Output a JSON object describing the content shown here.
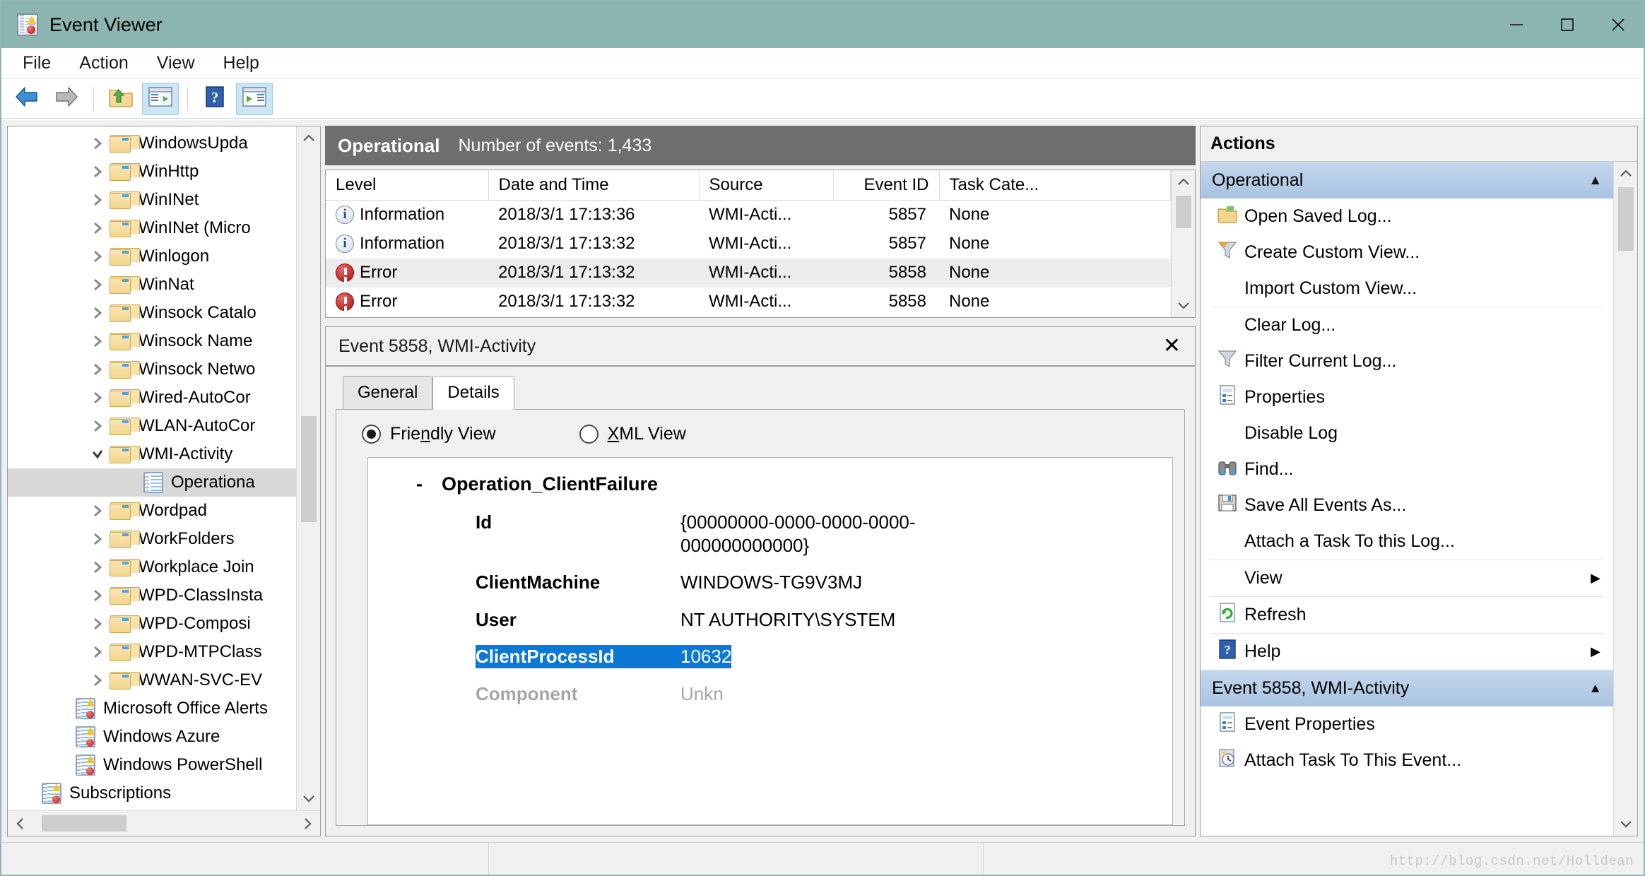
{
  "window": {
    "title": "Event Viewer",
    "icon": "event-viewer-icon",
    "minimize": "minimize-icon",
    "maximize": "maximize-icon",
    "close": "close-icon"
  },
  "menubar": {
    "items": [
      {
        "label": "File"
      },
      {
        "label": "Action"
      },
      {
        "label": "View"
      },
      {
        "label": "Help"
      }
    ]
  },
  "toolbar": {
    "buttons": [
      {
        "name": "back-button",
        "icon": "back-arrow-icon",
        "active": false
      },
      {
        "name": "forward-button",
        "icon": "forward-arrow-icon",
        "active": false
      },
      {
        "name": "up-one-level-button",
        "icon": "folder-up-icon",
        "active": false
      },
      {
        "name": "show-hide-console-tree-button",
        "icon": "console-tree-icon",
        "active": true
      },
      {
        "name": "help-button",
        "icon": "help-question-icon",
        "active": false
      },
      {
        "name": "show-hide-action-pane-button",
        "icon": "action-pane-icon",
        "active": true
      }
    ]
  },
  "tree": {
    "items": [
      {
        "label": "WindowsUpda",
        "icon": "folder-icon",
        "expander": "collapsed",
        "indent": 2,
        "selected": false
      },
      {
        "label": "WinHttp",
        "icon": "folder-icon",
        "expander": "collapsed",
        "indent": 2,
        "selected": false
      },
      {
        "label": "WinINet",
        "icon": "folder-icon",
        "expander": "collapsed",
        "indent": 2,
        "selected": false
      },
      {
        "label": "WinINet (Micro",
        "icon": "folder-icon",
        "expander": "collapsed",
        "indent": 2,
        "selected": false
      },
      {
        "label": "Winlogon",
        "icon": "folder-icon",
        "expander": "collapsed",
        "indent": 2,
        "selected": false
      },
      {
        "label": "WinNat",
        "icon": "folder-icon",
        "expander": "collapsed",
        "indent": 2,
        "selected": false
      },
      {
        "label": "Winsock Catalo",
        "icon": "folder-icon",
        "expander": "collapsed",
        "indent": 2,
        "selected": false
      },
      {
        "label": "Winsock Name",
        "icon": "folder-icon",
        "expander": "collapsed",
        "indent": 2,
        "selected": false
      },
      {
        "label": "Winsock Netwo",
        "icon": "folder-icon",
        "expander": "collapsed",
        "indent": 2,
        "selected": false
      },
      {
        "label": "Wired-AutoCor",
        "icon": "folder-icon",
        "expander": "collapsed",
        "indent": 2,
        "selected": false
      },
      {
        "label": "WLAN-AutoCor",
        "icon": "folder-icon",
        "expander": "collapsed",
        "indent": 2,
        "selected": false
      },
      {
        "label": "WMI-Activity",
        "icon": "folder-icon",
        "expander": "expanded",
        "indent": 2,
        "selected": false
      },
      {
        "label": "Operationa",
        "icon": "log-icon",
        "expander": "none",
        "indent": 3,
        "selected": true
      },
      {
        "label": "Wordpad",
        "icon": "folder-icon",
        "expander": "collapsed",
        "indent": 2,
        "selected": false
      },
      {
        "label": "WorkFolders",
        "icon": "folder-icon",
        "expander": "collapsed",
        "indent": 2,
        "selected": false
      },
      {
        "label": "Workplace Join",
        "icon": "folder-icon",
        "expander": "collapsed",
        "indent": 2,
        "selected": false
      },
      {
        "label": "WPD-ClassInsta",
        "icon": "folder-icon",
        "expander": "collapsed",
        "indent": 2,
        "selected": false
      },
      {
        "label": "WPD-Composi",
        "icon": "folder-icon",
        "expander": "collapsed",
        "indent": 2,
        "selected": false
      },
      {
        "label": "WPD-MTPClass",
        "icon": "folder-icon",
        "expander": "collapsed",
        "indent": 2,
        "selected": false
      },
      {
        "label": "WWAN-SVC-EV",
        "icon": "folder-icon",
        "expander": "collapsed",
        "indent": 2,
        "selected": false
      },
      {
        "label": "Microsoft Office Alerts",
        "icon": "event-log-alert-icon",
        "expander": "none",
        "indent": 1,
        "selected": false
      },
      {
        "label": "Windows Azure",
        "icon": "event-log-alert-icon",
        "expander": "none",
        "indent": 1,
        "selected": false
      },
      {
        "label": "Windows PowerShell",
        "icon": "event-log-alert-icon",
        "expander": "none",
        "indent": 1,
        "selected": false
      },
      {
        "label": "Subscriptions",
        "icon": "event-log-alert-icon",
        "expander": "none",
        "indent": 0,
        "selected": false
      }
    ]
  },
  "log": {
    "name": "Operational",
    "count_label": "Number of events: 1,433",
    "columns": [
      "Level",
      "Date and Time",
      "Source",
      "Event ID",
      "Task Cate..."
    ],
    "rows": [
      {
        "level": "Information",
        "level_icon": "information-icon",
        "datetime": "2018/3/1 17:13:36",
        "source": "WMI-Acti...",
        "event_id": "5857",
        "task_category": "None",
        "selected": false
      },
      {
        "level": "Information",
        "level_icon": "information-icon",
        "datetime": "2018/3/1 17:13:32",
        "source": "WMI-Acti...",
        "event_id": "5857",
        "task_category": "None",
        "selected": false
      },
      {
        "level": "Error",
        "level_icon": "error-icon",
        "datetime": "2018/3/1 17:13:32",
        "source": "WMI-Acti...",
        "event_id": "5858",
        "task_category": "None",
        "selected": true
      },
      {
        "level": "Error",
        "level_icon": "error-icon",
        "datetime": "2018/3/1 17:13:32",
        "source": "WMI-Acti...",
        "event_id": "5858",
        "task_category": "None",
        "selected": false
      }
    ]
  },
  "detail": {
    "title": "Event 5858, WMI-Activity",
    "close_icon": "close-icon",
    "tabs": [
      {
        "label": "General",
        "active": false
      },
      {
        "label": "Details",
        "active": true
      }
    ],
    "view_modes": [
      {
        "label_pre": "Frie",
        "label_key": "n",
        "label_post": "dly View",
        "selected": true
      },
      {
        "label_pre": "",
        "label_key": "X",
        "label_post": "ML View",
        "selected": false
      }
    ],
    "root_node": "Operation_ClientFailure",
    "collapse_marker": "-",
    "fields": [
      {
        "key": "Id",
        "value": "{00000000-0000-0000-0000-000000000000}",
        "selected": false
      },
      {
        "key": "ClientMachine",
        "value": "WINDOWS-TG9V3MJ",
        "selected": false
      },
      {
        "key": "User",
        "value": "NT AUTHORITY\\SYSTEM",
        "selected": false
      },
      {
        "key": "ClientProcessId",
        "value": "10632",
        "selected": true
      },
      {
        "key": "Component",
        "value": "Unkn",
        "selected": false
      }
    ]
  },
  "actions": {
    "title": "Actions",
    "groups": [
      {
        "header": "Operational",
        "collapse_icon": "triangle-up-icon",
        "items": [
          {
            "label": "Open Saved Log...",
            "icon": "open-saved-log-icon",
            "submenu": false,
            "separator_after": false
          },
          {
            "label": "Create Custom View...",
            "icon": "funnel-gold-icon",
            "submenu": false,
            "separator_after": false
          },
          {
            "label": "Import Custom View...",
            "icon": "none",
            "submenu": false,
            "separator_after": true
          },
          {
            "label": "Clear Log...",
            "icon": "none",
            "submenu": false,
            "separator_after": false
          },
          {
            "label": "Filter Current Log...",
            "icon": "funnel-icon",
            "submenu": false,
            "separator_after": false
          },
          {
            "label": "Properties",
            "icon": "properties-icon",
            "submenu": false,
            "separator_after": false
          },
          {
            "label": "Disable Log",
            "icon": "none",
            "submenu": false,
            "separator_after": false
          },
          {
            "label": "Find...",
            "icon": "binoculars-icon",
            "submenu": false,
            "separator_after": false
          },
          {
            "label": "Save All Events As...",
            "icon": "save-disk-icon",
            "submenu": false,
            "separator_after": false
          },
          {
            "label": "Attach a Task To this Log...",
            "icon": "none",
            "submenu": false,
            "separator_after": true
          },
          {
            "label": "View",
            "icon": "none",
            "submenu": true,
            "separator_after": true
          },
          {
            "label": "Refresh",
            "icon": "refresh-icon",
            "submenu": false,
            "separator_after": true
          },
          {
            "label": "Help",
            "icon": "help-question-icon",
            "submenu": true,
            "separator_after": false
          }
        ]
      },
      {
        "header": "Event 5858, WMI-Activity",
        "collapse_icon": "triangle-up-icon",
        "items": [
          {
            "label": "Event Properties",
            "icon": "properties-icon",
            "submenu": false,
            "separator_after": false
          },
          {
            "label": "Attach Task To This Event...",
            "icon": "attach-task-icon",
            "submenu": false,
            "separator_after": false
          }
        ]
      }
    ],
    "submenu_icon": "chevron-right-icon"
  },
  "statusbar": {
    "watermark": "http://blog.csdn.net/Holldean"
  },
  "colors": {
    "titlebar": "#8cb5b0",
    "log_header": "#6e6e6e",
    "selection_blue": "#0a78d4",
    "group_header": "#a9c3e0",
    "error_red": "#b00d0d",
    "info_blue": "#1a4c9c"
  }
}
